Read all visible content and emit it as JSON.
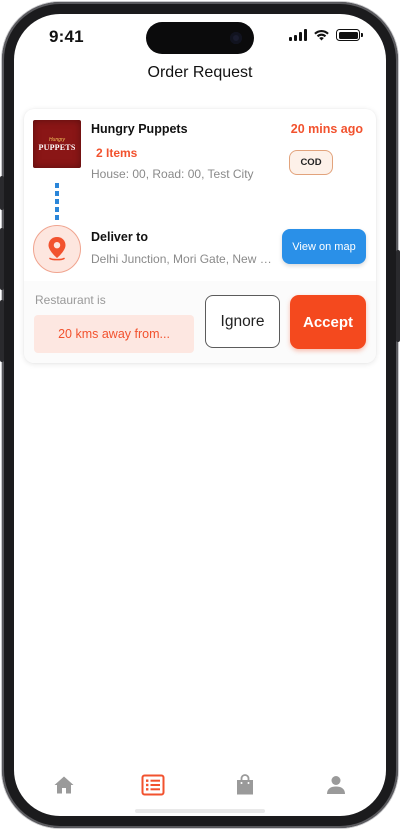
{
  "status_bar": {
    "time": "9:41"
  },
  "header": {
    "title": "Order Request"
  },
  "order": {
    "restaurant_logo": {
      "line1": "Hungry",
      "line2": "PUPPETS"
    },
    "restaurant_name": "Hungry Puppets",
    "time_ago": "20 mins ago",
    "items": "2 Items",
    "payment_badge": "COD",
    "pickup_address": "House: 00, Road: 00, Test City",
    "deliver_label": "Deliver to",
    "delivery_address": "Delhi Junction, Mori Gate, New Delhi",
    "view_map_label": "View on map",
    "distance_caption": "Restaurant is",
    "distance_text": "20 kms away from...",
    "ignore_label": "Ignore",
    "accept_label": "Accept"
  },
  "bottom_nav": {
    "items": [
      {
        "icon": "home-icon",
        "active": false
      },
      {
        "icon": "order-list-icon",
        "active": true
      },
      {
        "icon": "shopping-bag-icon",
        "active": false
      },
      {
        "icon": "profile-icon",
        "active": false
      }
    ]
  },
  "colors": {
    "accent": "#f2522e",
    "accept": "#f4491e",
    "map_button": "#2a90e8",
    "nav_inactive": "#9a9a9a"
  }
}
